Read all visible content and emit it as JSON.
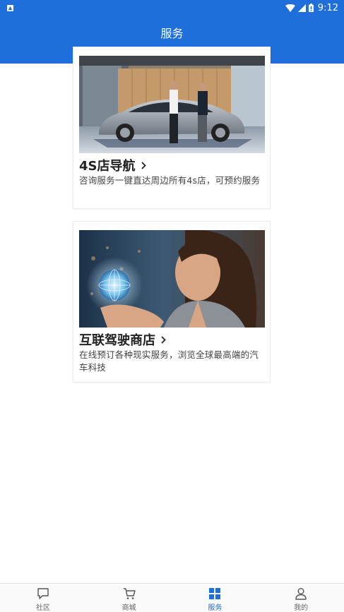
{
  "status_bar": {
    "time": "9:12",
    "icons": [
      "notification-icon",
      "wifi-icon",
      "signal-icon",
      "battery-icon"
    ]
  },
  "header": {
    "title": "服务"
  },
  "cards": [
    {
      "title": "4S店导航",
      "description": "咨询服务一键直达周边所有4s店，可预约服务",
      "image": "car-dealership-photo"
    },
    {
      "title": "互联驾驶商店",
      "description": "在线预订各种现实服务，浏览全球最高端的汽车科技",
      "image": "woman-holding-globe-photo"
    }
  ],
  "bottom_nav": {
    "items": [
      {
        "label": "社区",
        "icon": "chat-bubble-icon",
        "active": false
      },
      {
        "label": "商城",
        "icon": "shopping-cart-icon",
        "active": false
      },
      {
        "label": "服务",
        "icon": "grid-icon",
        "active": true
      },
      {
        "label": "我的",
        "icon": "person-icon",
        "active": false
      }
    ]
  },
  "colors": {
    "primary": "#1e6fdc",
    "text_dark": "#222222",
    "text_body": "#444444",
    "nav_inactive": "#666666"
  }
}
